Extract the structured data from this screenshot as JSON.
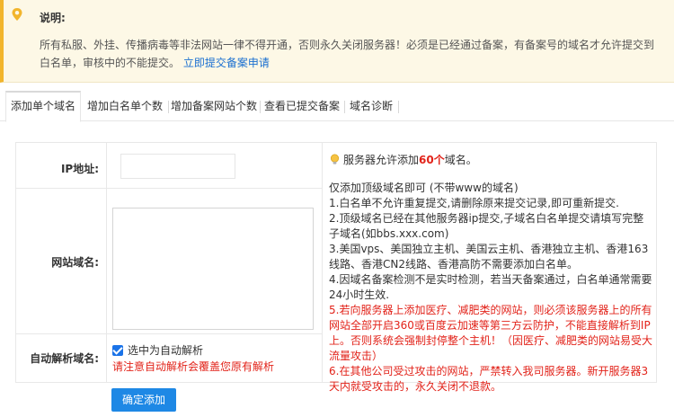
{
  "notice": {
    "title": "说明:",
    "text": "所有私服、外挂、传播病毒等非法网站一律不得开通，否则永久关闭服务器！必须是已经通过备案，有备案号的域名才允许提交到白名单，审核中的不能提交。",
    "link": "立即提交备案申请",
    "icon": "location-pin-icon",
    "accent": "#f2b52c"
  },
  "tabs": [
    {
      "label": "添加单个域名",
      "active": true
    },
    {
      "label": "增加白名单个数",
      "active": false
    },
    {
      "label": "增加备案网站个数",
      "active": false
    },
    {
      "label": "查看已提交备案",
      "active": false
    },
    {
      "label": "域名诊断",
      "active": false
    }
  ],
  "form": {
    "ip_label": "IP地址:",
    "ip_value": "",
    "domain_label": "网站域名:",
    "domain_value": "",
    "auto_label": "自动解析域名:",
    "auto_checkbox_label": "选中为自动解析",
    "auto_checked": true,
    "auto_warning": "请注意自动解析会覆盖您原有解析"
  },
  "info": {
    "allow_prefix": "服务器允许添加",
    "allow_count": "60个",
    "allow_suffix": "域名。",
    "rules_intro": "仅添加顶级域名即可 (不带www的域名)",
    "rule1": "1.白名单不允许重复提交,请删除原来提交记录,即可重新提交.",
    "rule2": "2.顶级域名已经在其他服务器ip提交,子域名白名单提交请填写完整子域名(如bbs.xxx.com)",
    "rule3": "3.美国vps、美国独立主机、美国云主机、香港独立主机、香港163线路、香港CN2线路、香港高防不需要添加白名单。",
    "rule4": "4.因域名备案检测不是实时检测，若当天备案通过，白名单通常需要24小时生效.",
    "rule5": "5.若向服务器上添加医疗、减肥类的网站，则必须该服务器上的所有网站全部开启360或百度云加速等第三方云防护，不能直接解析到IP上。否则系统会强制封停整个主机！（因医疗、减肥类的网站易受大流量攻击）",
    "rule6": "6.在其他公司受过攻击的网站，严禁转入我司服务器。新开服务器3天内就受攻击的，永久关闭不退款。",
    "highlight_color": "#e2231a"
  },
  "submit_label": "确定添加"
}
